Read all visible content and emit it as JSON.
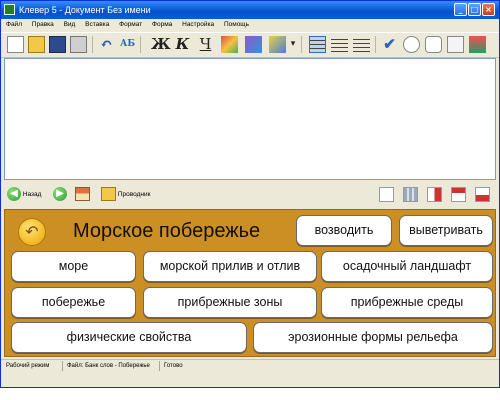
{
  "window": {
    "title": "Клевер 5 - Документ Без имени"
  },
  "menu": [
    "Файл",
    "Правка",
    "Вид",
    "Вставка",
    "Формат",
    "Форма",
    "Настройка",
    "Помощь"
  ],
  "toolbar": {
    "bold_glyph": "Ж",
    "italic_glyph": "К",
    "underline_glyph": "Ч"
  },
  "nav": {
    "back_label": "Назад",
    "explorer_label": "Проводник"
  },
  "panel": {
    "heading": "Морское побережье",
    "accent_color": "#cc8f24",
    "verb_buttons": [
      "возводить",
      "выветривать"
    ],
    "word_buttons": [
      "море",
      "морской прилив и отлив",
      "осадочный ландшафт",
      "побережье",
      "прибрежные зоны",
      "прибрежные среды",
      "физические свойства",
      "эрозионные формы рельефа"
    ]
  },
  "status": {
    "mode": "Рабочий режим",
    "file": "Файл: Банк слов - Побережье",
    "state": "Готово"
  }
}
